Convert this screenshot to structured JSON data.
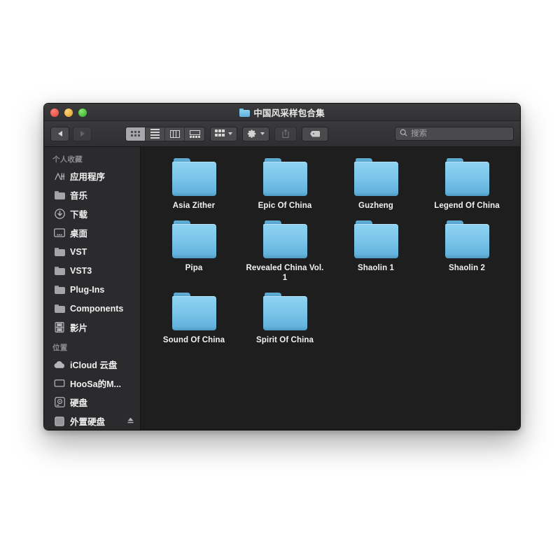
{
  "window": {
    "title": "中国风采样包合集",
    "title_icon": "folder-icon",
    "traffic_lights": {
      "close": "close-button",
      "minimize": "minimize-button",
      "maximize": "maximize-button"
    }
  },
  "toolbar": {
    "back_label": "",
    "forward_label": "",
    "view_modes": [
      {
        "name": "icon-view",
        "active": true
      },
      {
        "name": "list-view",
        "active": false
      },
      {
        "name": "column-view",
        "active": false
      },
      {
        "name": "gallery-view",
        "active": false
      }
    ],
    "arrange_button": "arrange-by-button",
    "action_button": "action-gear-button",
    "share_button": "share-button",
    "tag_button": "tag-button",
    "search": {
      "placeholder": "搜索",
      "value": ""
    }
  },
  "sidebar": {
    "sections": [
      {
        "header": "个人收藏",
        "items": [
          {
            "label": "应用程序",
            "icon": "applications-icon"
          },
          {
            "label": "音乐",
            "icon": "folder-icon"
          },
          {
            "label": "下载",
            "icon": "downloads-icon"
          },
          {
            "label": "桌面",
            "icon": "desktop-icon"
          },
          {
            "label": "VST",
            "icon": "folder-icon"
          },
          {
            "label": "VST3",
            "icon": "folder-icon"
          },
          {
            "label": "Plug-Ins",
            "icon": "folder-icon"
          },
          {
            "label": "Components",
            "icon": "folder-icon"
          },
          {
            "label": "影片",
            "icon": "movies-icon"
          }
        ]
      },
      {
        "header": "位置",
        "items": [
          {
            "label": "iCloud 云盘",
            "icon": "icloud-icon"
          },
          {
            "label": "HooSa的M...",
            "icon": "laptop-icon"
          },
          {
            "label": "硬盘",
            "icon": "hard-disk-icon"
          },
          {
            "label": "外置硬盘",
            "icon": "external-disk-icon",
            "eject": true
          }
        ]
      }
    ]
  },
  "content": {
    "items": [
      {
        "name": "Asia Zither",
        "icon": "folder-icon"
      },
      {
        "name": "Epic Of China",
        "icon": "folder-icon"
      },
      {
        "name": "Guzheng",
        "icon": "folder-icon"
      },
      {
        "name": "Legend Of China",
        "icon": "folder-icon"
      },
      {
        "name": "Pipa",
        "icon": "folder-icon"
      },
      {
        "name": "Revealed China Vol. 1",
        "icon": "folder-icon"
      },
      {
        "name": "Shaolin 1",
        "icon": "folder-icon"
      },
      {
        "name": "Shaolin 2",
        "icon": "folder-icon"
      },
      {
        "name": "Sound Of China",
        "icon": "folder-icon"
      },
      {
        "name": "Spirit Of China",
        "icon": "folder-icon"
      }
    ]
  },
  "colors": {
    "folder_blue": "#7cc6ea",
    "window_chrome": "#3a3a3c",
    "sidebar_bg": "#2b2b2d",
    "content_bg": "#1e1e1f",
    "close_red": "#e0443e",
    "minimize_yellow": "#dea123",
    "maximize_green": "#29a92c"
  }
}
